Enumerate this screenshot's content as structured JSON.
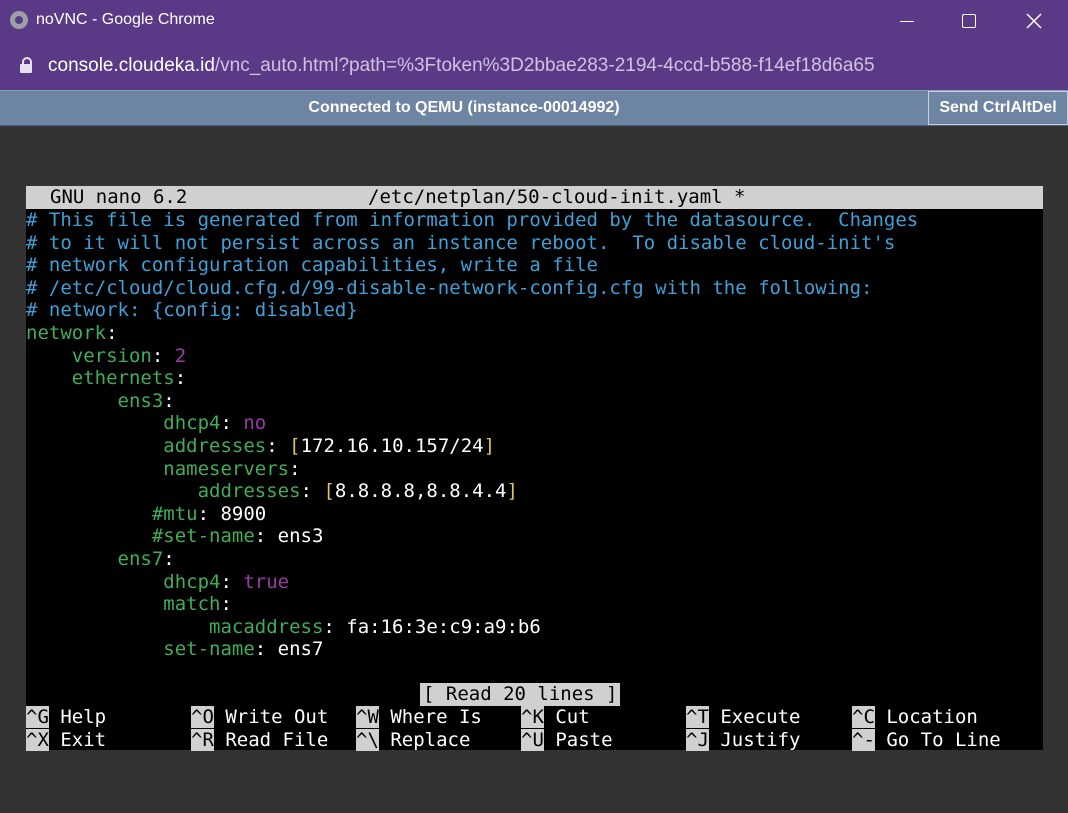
{
  "window": {
    "title": "noVNC - Google Chrome"
  },
  "address_bar": {
    "host": "console.cloudeka.id",
    "path": "/vnc_auto.html?path=%3Ftoken%3D2bbae283-2194-4ccd-b588-f14ef18d6a65"
  },
  "novnc": {
    "status": "Connected to QEMU (instance-00014992)",
    "send_cad_label": "Send CtrlAltDel"
  },
  "nano": {
    "version": "GNU nano 6.2",
    "filename": "/etc/netplan/50-cloud-init.yaml *",
    "lines": [
      [
        {
          "t": "# This file is generated from information provided by the datasource.  Changes",
          "c": "comment"
        }
      ],
      [
        {
          "t": "# to it will not persist across an instance reboot.  To disable cloud-init's",
          "c": "comment"
        }
      ],
      [
        {
          "t": "# network configuration capabilities, write a file",
          "c": "comment"
        }
      ],
      [
        {
          "t": "# /etc/cloud/cloud.cfg.d/99-disable-network-config.cfg with the following:",
          "c": "comment"
        }
      ],
      [
        {
          "t": "# network: {config: disabled}",
          "c": "comment"
        }
      ],
      [
        {
          "t": "network",
          "c": "key"
        },
        {
          "t": ":",
          "c": "str"
        }
      ],
      [
        {
          "t": "    version",
          "c": "key"
        },
        {
          "t": ": ",
          "c": "str"
        },
        {
          "t": "2",
          "c": "num"
        }
      ],
      [
        {
          "t": "    ethernets",
          "c": "key"
        },
        {
          "t": ":",
          "c": "str"
        }
      ],
      [
        {
          "t": "        ens3",
          "c": "key"
        },
        {
          "t": ":",
          "c": "str"
        }
      ],
      [
        {
          "t": "            dhcp4",
          "c": "key"
        },
        {
          "t": ": ",
          "c": "str"
        },
        {
          "t": "no",
          "c": "num"
        }
      ],
      [
        {
          "t": "            addresses",
          "c": "key"
        },
        {
          "t": ": ",
          "c": "str"
        },
        {
          "t": "[",
          "c": "br"
        },
        {
          "t": "172.16.10.157/24",
          "c": "str"
        },
        {
          "t": "]",
          "c": "br"
        }
      ],
      [
        {
          "t": "            nameservers",
          "c": "key"
        },
        {
          "t": ":",
          "c": "str"
        }
      ],
      [
        {
          "t": "               addresses",
          "c": "key"
        },
        {
          "t": ": ",
          "c": "str"
        },
        {
          "t": "[",
          "c": "br"
        },
        {
          "t": "8.8.8.8,8.8.4.4",
          "c": "str"
        },
        {
          "t": "]",
          "c": "br"
        }
      ],
      [
        {
          "t": "           #mtu",
          "c": "key"
        },
        {
          "t": ": 8900",
          "c": "str"
        }
      ],
      [
        {
          "t": "           #set-name",
          "c": "key"
        },
        {
          "t": ": ens3",
          "c": "str"
        }
      ],
      [
        {
          "t": "        ens7",
          "c": "key"
        },
        {
          "t": ":",
          "c": "str"
        }
      ],
      [
        {
          "t": "            dhcp4",
          "c": "key"
        },
        {
          "t": ": ",
          "c": "str"
        },
        {
          "t": "true",
          "c": "num"
        }
      ],
      [
        {
          "t": "            match",
          "c": "key"
        },
        {
          "t": ":",
          "c": "str"
        }
      ],
      [
        {
          "t": "                macaddress",
          "c": "key"
        },
        {
          "t": ": fa:16:3e:c9:a9:b6",
          "c": "str"
        }
      ],
      [
        {
          "t": "            set-name",
          "c": "key"
        },
        {
          "t": ": ens7",
          "c": "str"
        }
      ]
    ],
    "status_message": "[ Read 20 lines ]",
    "shortcuts": [
      [
        {
          "key": "^G",
          "label": "Help"
        },
        {
          "key": "^O",
          "label": "Write Out"
        },
        {
          "key": "^W",
          "label": "Where Is"
        },
        {
          "key": "^K",
          "label": "Cut"
        },
        {
          "key": "^T",
          "label": "Execute"
        },
        {
          "key": "^C",
          "label": "Location"
        }
      ],
      [
        {
          "key": "^X",
          "label": "Exit"
        },
        {
          "key": "^R",
          "label": "Read File"
        },
        {
          "key": "^\\",
          "label": "Replace"
        },
        {
          "key": "^U",
          "label": "Paste"
        },
        {
          "key": "^J",
          "label": "Justify"
        },
        {
          "key": "^-",
          "label": "Go To Line"
        }
      ]
    ]
  }
}
